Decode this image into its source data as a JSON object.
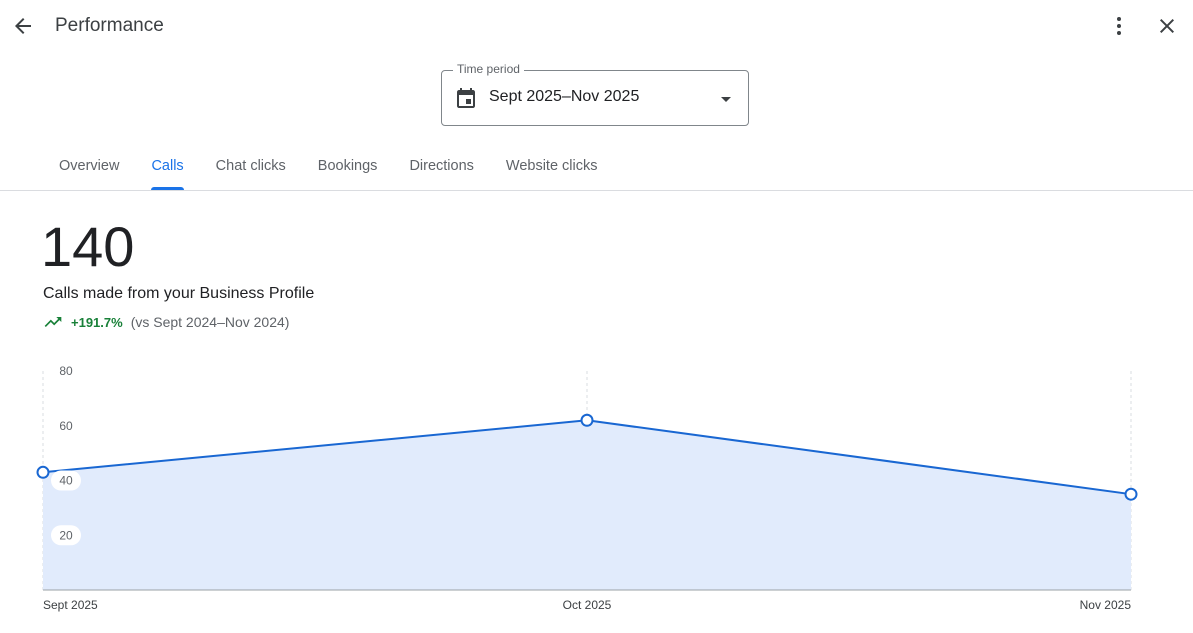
{
  "header": {
    "title": "Performance",
    "back_icon": "arrow-back-icon",
    "more_icon": "more-vert-icon",
    "close_icon": "close-icon"
  },
  "time_period": {
    "label": "Time period",
    "value": "Sept 2025–Nov 2025",
    "icon": "calendar-icon"
  },
  "tabs": [
    {
      "label": "Overview",
      "active": false
    },
    {
      "label": "Calls",
      "active": true
    },
    {
      "label": "Chat clicks",
      "active": false
    },
    {
      "label": "Bookings",
      "active": false
    },
    {
      "label": "Directions",
      "active": false
    },
    {
      "label": "Website clicks",
      "active": false
    }
  ],
  "metric": {
    "value": "140",
    "description": "Calls made from your Business Profile",
    "change": "+191.7%",
    "comparison": "(vs Sept 2024–Nov 2024)"
  },
  "colors": {
    "accent": "#1a73e8",
    "line": "#1967d2",
    "area_fill": "#e1ebfc",
    "positive": "#188038"
  },
  "chart_data": {
    "type": "area",
    "categories": [
      "Sept 2025",
      "Oct 2025",
      "Nov 2025"
    ],
    "values": [
      43,
      62,
      35
    ],
    "ylim": [
      0,
      80
    ],
    "yticks": [
      20,
      40,
      60,
      80
    ],
    "grid": "vertical-dashed"
  }
}
